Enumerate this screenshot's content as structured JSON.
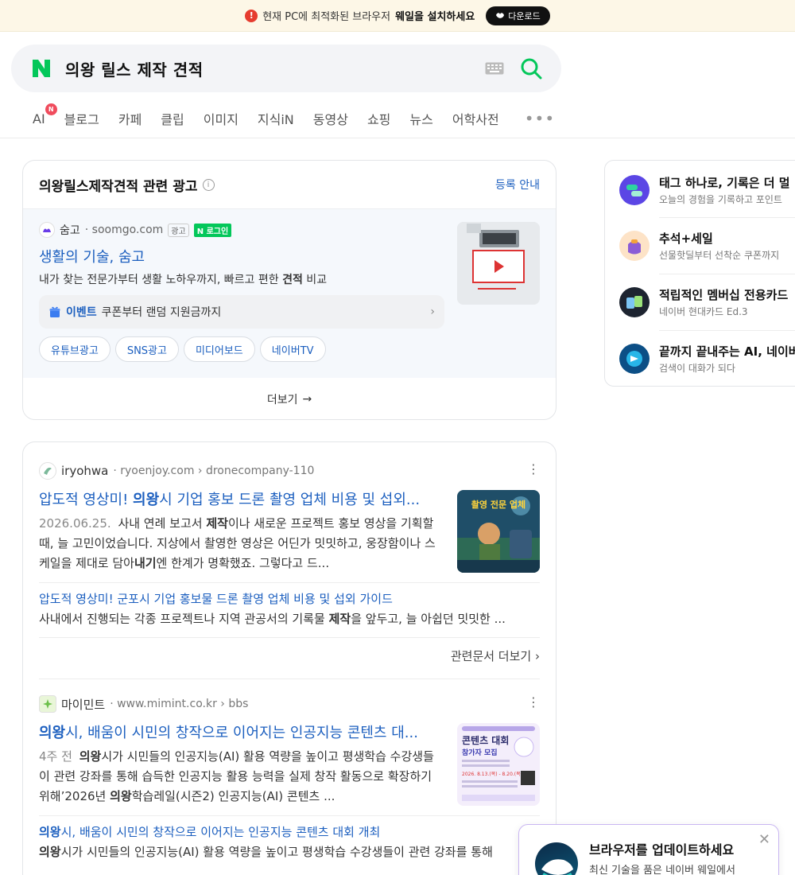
{
  "banner": {
    "text": "현재 PC에 최적화된 브라우저",
    "strong": "웨일을 설치하세요",
    "download_label": "다운로드"
  },
  "search": {
    "query": "의왕 릴스 제작 견적"
  },
  "tabs": [
    {
      "label": "AI",
      "badge": "N"
    },
    {
      "label": "블로그"
    },
    {
      "label": "카페"
    },
    {
      "label": "클립"
    },
    {
      "label": "이미지"
    },
    {
      "label": "지식iN"
    },
    {
      "label": "동영상"
    },
    {
      "label": "쇼핑"
    },
    {
      "label": "뉴스"
    },
    {
      "label": "어학사전"
    }
  ],
  "ad": {
    "title": "의왕릴스제작견적 관련 광고",
    "register": "등록 안내",
    "source_name": "숨고",
    "domain": "soomgo.com",
    "ad_label": "광고",
    "login_label": "로그인",
    "headline": "생활의 기술, 숨고",
    "desc_before": "내가 찾는 전문가부터 생활 노하우까지, 빠르고 편한 ",
    "desc_bold": "견적",
    "desc_after": " 비교",
    "event_label": "이벤트",
    "event_text": "쿠폰부터 랜덤 지원금까지",
    "chips": [
      "유튜브광고",
      "SNS광고",
      "미디어보드",
      "네이버TV"
    ],
    "more": "더보기"
  },
  "results": [
    {
      "name": "iryohwa",
      "path": "ryoenjoy.com › dronecompany-110",
      "title_pre": "압도적 영상미! ",
      "title_bold": "의왕",
      "title_post": "시 기업 홍보 드론 촬영 업체 비용 및 섭외...",
      "date": "2026.06.25.",
      "snippet_1": "사내 연례 보고서 ",
      "snippet_bold_1": "제작",
      "snippet_2": "이나 새로운 프로젝트 홍보 영상을 기획할 때, 늘 고민이었습니다. 지상에서 촬영한 영상은 어딘가 밋밋하고, 웅장함이나 스케일을 제대로 담아",
      "snippet_bold_2": "내기",
      "snippet_3": "엔 한계가 명확했죠. 그렇다고 드...",
      "sub_title": "압도적 영상미! 군포시 기업 홍보물 드론 촬영 업체 비용 및 섭외 가이드",
      "sub_snip_1": "사내에서 진행되는 각종 프로젝트나 지역 관공서의 기록물 ",
      "sub_snip_bold": "제작",
      "sub_snip_2": "을 앞두고, 늘 아쉽던 밋밋한 ...",
      "related": "관련문서 더보기",
      "thumb_text": "촬영 전문 업체"
    },
    {
      "name": "마이민트",
      "path": "www.mimint.co.kr › bbs",
      "title_bold": "의왕",
      "title_post": "시, 배움이 시민의 창작으로 이어지는 인공지능 콘텐츠 대...",
      "date": "4주 전",
      "snippet_bold_1": "의왕",
      "snippet_1": "시가 시민들의 인공지능(AI) 활용 역량을 높이고 평생학습 수강생들이 관련 강좌를 통해 습득한 인공지능 활용 능력을 실제 창작 활동으로 확장하기 위해’2026년 ",
      "snippet_bold_2": "의왕",
      "snippet_2": "학습레일(시즌2) 인공지능(AI) 콘텐츠 ...",
      "sub_title_bold": "의왕",
      "sub_title": "시, 배움이 시민의 창작으로 이어지는 인공지능 콘텐츠 대회 개최",
      "sub_snip_bold": "의왕",
      "sub_snip": "시가 시민들의 인공지능(AI) 활용 역량을 높이고 평생학습 수강생들이 관련 강좌를 통해",
      "thumb_title": "콘텐츠 대회",
      "thumb_sub": "참가자 모집",
      "thumb_date": "2026. 8.13.(목) - 8.20.(목)"
    }
  ],
  "sidebar": [
    {
      "title": "태그 하나로, 기록은 더 멀",
      "sub": "오늘의 경험을 기록하고 포인트"
    },
    {
      "title": "추석+세일",
      "sub": "선물핫딜부터 선착순 쿠폰까지"
    },
    {
      "title": "적립적인 멤버십 전용카드",
      "sub": "네이버 현대카드 Ed.3"
    },
    {
      "title": "끝까지 끝내주는 AI, 네이버",
      "sub": "검색이 대화가 되다"
    }
  ],
  "popup": {
    "title": "브라우저를 업데이트하세요",
    "sub": "최신 기술을 품은 네이버 웨일에서"
  },
  "colors": {
    "naver_green": "#03c75a",
    "link_blue": "#1c5fbf",
    "banner_bg": "#fdf7e7"
  }
}
